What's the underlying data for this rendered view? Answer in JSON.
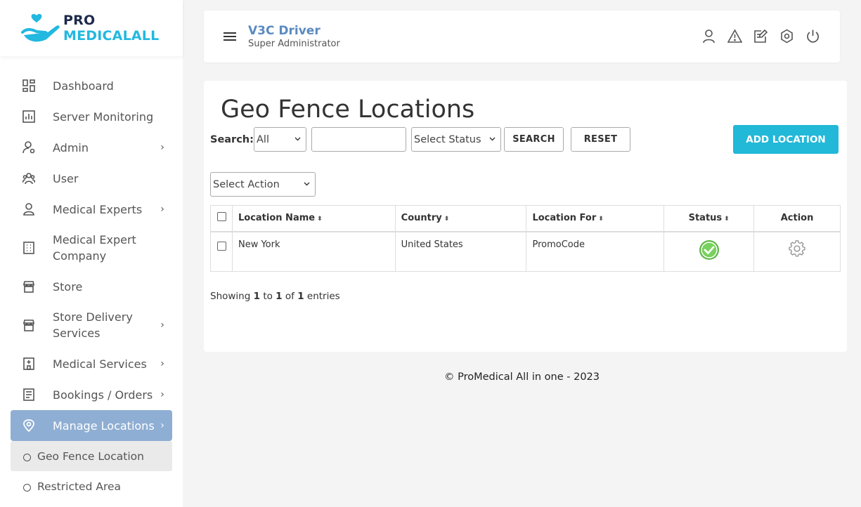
{
  "brand": {
    "part1": "PRO",
    "part2": "MEDICALALL"
  },
  "sidebar": {
    "items": [
      {
        "label": "Dashboard",
        "icon": "dashboard-icon",
        "arrow": false
      },
      {
        "label": "Server Monitoring",
        "icon": "chart-icon",
        "arrow": false
      },
      {
        "label": "Admin",
        "icon": "admin-icon",
        "arrow": true
      },
      {
        "label": "User",
        "icon": "users-icon",
        "arrow": false
      },
      {
        "label": "Medical Experts",
        "icon": "person-icon",
        "arrow": true
      },
      {
        "label": "Medical Expert Company",
        "icon": "building-icon",
        "arrow": false
      },
      {
        "label": "Store",
        "icon": "store-icon",
        "arrow": false
      },
      {
        "label": "Store Delivery Services",
        "icon": "store-icon",
        "arrow": true
      },
      {
        "label": "Medical Services",
        "icon": "hospital-icon",
        "arrow": true
      },
      {
        "label": "Bookings / Orders",
        "icon": "list-icon",
        "arrow": true
      },
      {
        "label": "Manage Locations",
        "icon": "location-icon",
        "arrow": true,
        "active": true
      }
    ],
    "subitems": [
      {
        "label": "Geo Fence Location",
        "active": true
      },
      {
        "label": "Restricted Area",
        "active": false
      }
    ],
    "arrow_glyph": "›"
  },
  "header": {
    "user_name": "V3C Driver",
    "user_role": "Super Administrator",
    "icons": [
      "profile-icon",
      "alert-icon",
      "edit-icon",
      "settings-icon",
      "power-icon"
    ]
  },
  "main": {
    "title": "Geo Fence Locations",
    "search_label": "Search:",
    "search_scope": "All",
    "search_value": "",
    "status_select": "Select Status",
    "search_button": "SEARCH",
    "reset_button": "RESET",
    "add_button": "ADD LOCATION",
    "action_select": "Select Action",
    "table": {
      "columns": [
        "Location Name",
        "Country",
        "Location For",
        "Status",
        "Action"
      ],
      "sort_glyph": "⬍",
      "rows": [
        {
          "name": "New York",
          "country": "United States",
          "for": "PromoCode",
          "status": "active"
        }
      ]
    },
    "showing": {
      "prefix": "Showing",
      "from": "1",
      "to_word": "to",
      "to": "1",
      "of_word": "of",
      "total": "1",
      "suffix": "entries"
    }
  },
  "footer": {
    "text": "© ProMedical All in one - 2023"
  },
  "colors": {
    "accent": "#22b8d8",
    "active_nav": "#8faed3",
    "status_ok": "#6fcf4f",
    "brand_dark": "#1e2a4a"
  }
}
